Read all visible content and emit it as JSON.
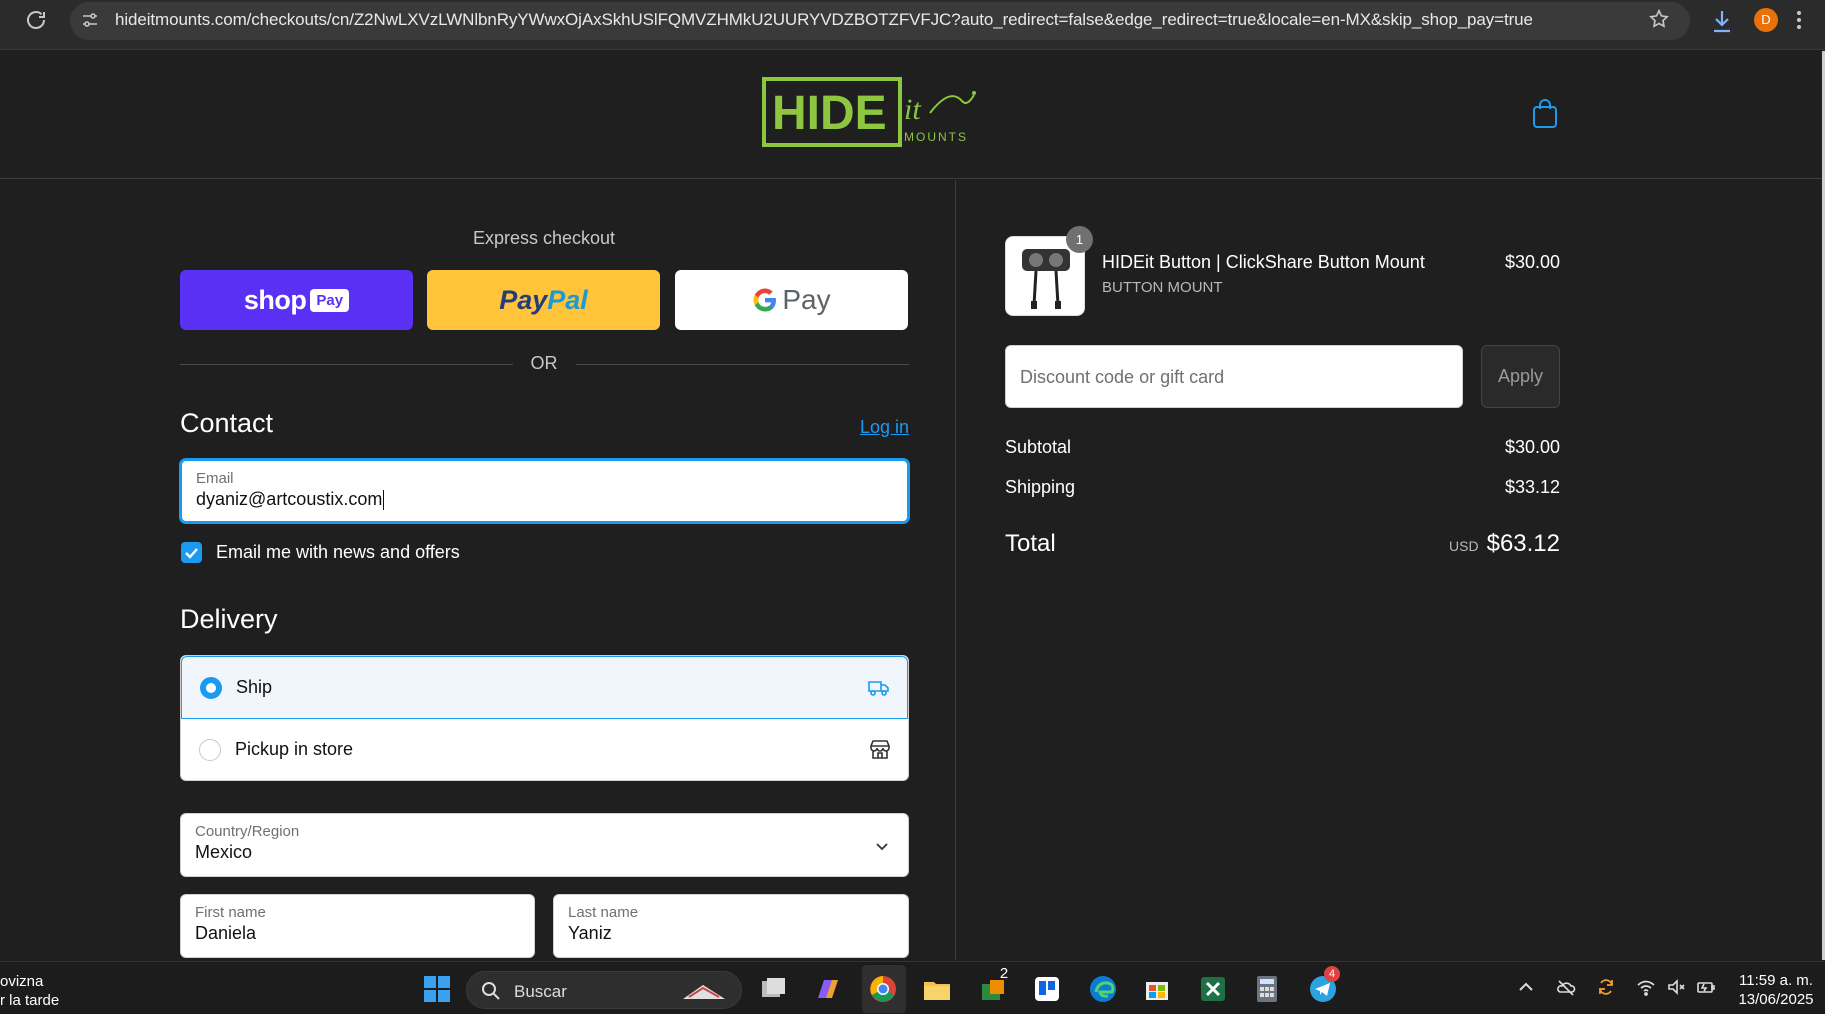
{
  "browser": {
    "url": "hideitmounts.com/checkouts/cn/Z2NwLXVzLWNlbnRyYWwxOjAxSkhUSlFQMVZHMkU2UURYVDZBOTZFVFJC?auto_redirect=false&edge_redirect=true&locale=en-MX&skip_shop_pay=true",
    "profile_initial": "D"
  },
  "header": {
    "logo_text": "HIDE",
    "logo_script": "it",
    "logo_sub": "MOUNTS"
  },
  "express": {
    "title": "Express checkout",
    "shop_label": "shop",
    "shop_pay_label": "Pay",
    "paypal_pay": "Pay",
    "paypal_pal": "Pal",
    "gpay_label": "Pay",
    "or_label": "OR"
  },
  "contact": {
    "title": "Contact",
    "login_label": "Log in",
    "email_label": "Email",
    "email_value": "dyaniz@artcoustix.com",
    "newsletter_label": "Email me with news and offers",
    "newsletter_checked": true
  },
  "delivery": {
    "title": "Delivery",
    "options": [
      {
        "label": "Ship",
        "selected": true
      },
      {
        "label": "Pickup in store",
        "selected": false
      }
    ],
    "country_label": "Country/Region",
    "country_value": "Mexico",
    "first_name_label": "First name",
    "first_name_value": "Daniela",
    "last_name_label": "Last name",
    "last_name_value": "Yaniz"
  },
  "summary": {
    "item": {
      "name": "HIDEit Button | ClickShare Button Mount",
      "variant": "BUTTON MOUNT",
      "price": "$30.00",
      "quantity": "1"
    },
    "discount_placeholder": "Discount code or gift card",
    "apply_label": "Apply",
    "subtotal_label": "Subtotal",
    "subtotal_value": "$30.00",
    "shipping_label": "Shipping",
    "shipping_value": "$33.12",
    "total_label": "Total",
    "total_currency": "USD",
    "total_value": "$63.12"
  },
  "taskbar": {
    "weather_line1": "ovizna",
    "weather_line2": "r la tarde",
    "search_label": "Buscar",
    "badge_app1": "2",
    "badge_telegram": "4",
    "time": "11:59 a. m.",
    "date": "13/06/2025"
  },
  "colors": {
    "accent": "#1a9bf0",
    "shop_pay": "#5a31f4",
    "paypal": "#ffc439",
    "logo_green": "#8dc63f"
  }
}
